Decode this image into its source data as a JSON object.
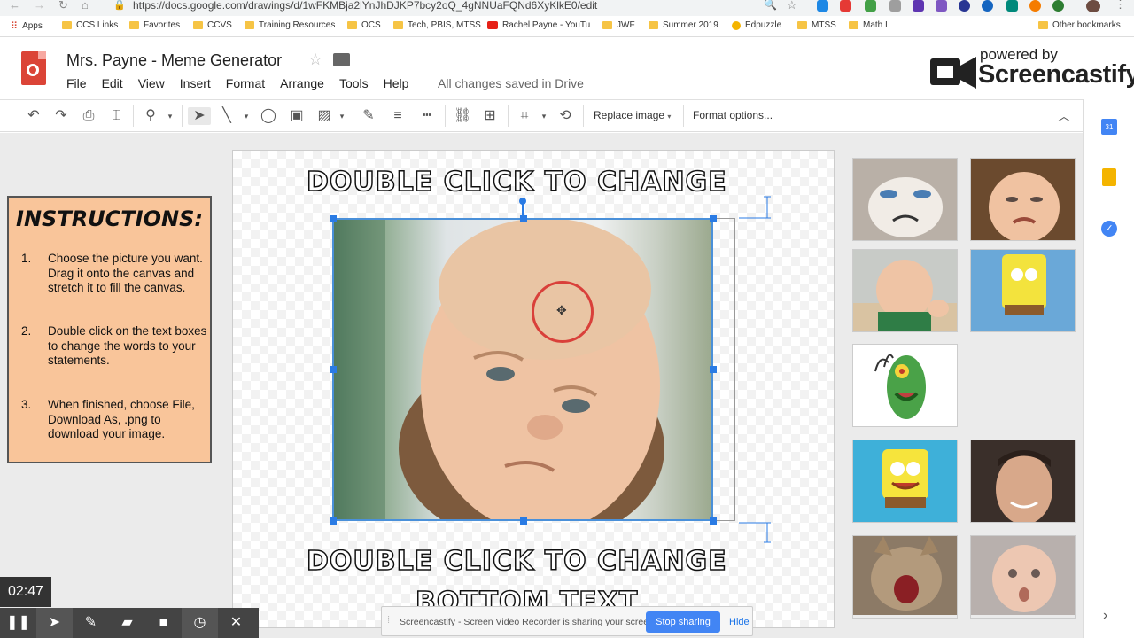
{
  "browser": {
    "url": "https://docs.google.com/drawings/d/1wFKMBja2lYnJhDJKP7bcy2oQ_4gNNUaFQNd6XyKlkE0/edit",
    "bookmarks": [
      "Apps",
      "CCS Links",
      "Favorites",
      "CCVS",
      "Training Resources",
      "OCS",
      "Tech, PBIS, MTSS",
      "Rachel Payne - YouTu",
      "JWF",
      "Summer 2019",
      "Edpuzzle",
      "MTSS",
      "Math I",
      "Other bookmarks"
    ]
  },
  "doc": {
    "title": "Mrs. Payne - Meme Generator",
    "menus": [
      "File",
      "Edit",
      "View",
      "Insert",
      "Format",
      "Arrange",
      "Tools",
      "Help"
    ],
    "saved_status": "All changes saved in Drive"
  },
  "watermark": {
    "line1": "powered by",
    "line2": "Screencastify"
  },
  "toolbar": {
    "replace_image": "Replace image",
    "format_options": "Format options..."
  },
  "instructions": {
    "title": "INSTRUCTIONS:",
    "steps": [
      {
        "num": "1.",
        "text": "Choose the picture you want. Drag it onto the canvas and stretch it to fill the canvas."
      },
      {
        "num": "2.",
        "text": "Double click on the text boxes to change the words to your statements."
      },
      {
        "num": "3.",
        "text": "When finished, choose File, Download As, .png to download your image."
      }
    ]
  },
  "canvas": {
    "top_text": "Double click to change",
    "bottom_text": "Double click to change",
    "bottom_text_2": "bottom text"
  },
  "recorder": {
    "timer": "02:47",
    "share_message": "Screencastify - Screen Video Recorder is sharing your screen.",
    "stop_label": "Stop sharing",
    "hide_label": "Hide"
  }
}
